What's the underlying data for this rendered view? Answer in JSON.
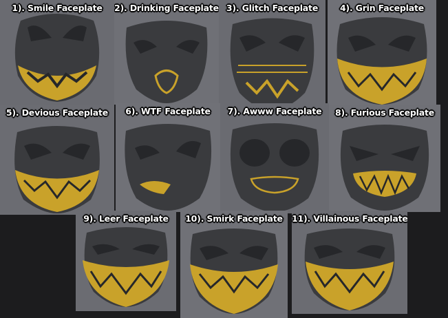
{
  "colors": {
    "background": "#1c1c1e",
    "tile": "#6a6b71",
    "mask": "#3a3b3e",
    "accent": "#c9a22a",
    "label": "#ffffff"
  },
  "faceplates": [
    {
      "label": "1). Smile Faceplate"
    },
    {
      "label": "2). Drinking Faceplate"
    },
    {
      "label": "3). Glitch Faceplate"
    },
    {
      "label": "4). Grin Faceplate"
    },
    {
      "label": "5). Devious Faceplate"
    },
    {
      "label": "6). WTF Faceplate"
    },
    {
      "label": "7). Awww Faceplate"
    },
    {
      "label": "8). Furious Faceplate"
    },
    {
      "label": "9). Leer Faceplate"
    },
    {
      "label": "10). Smirk Faceplate"
    },
    {
      "label": "11). Villainous Faceplate"
    }
  ]
}
